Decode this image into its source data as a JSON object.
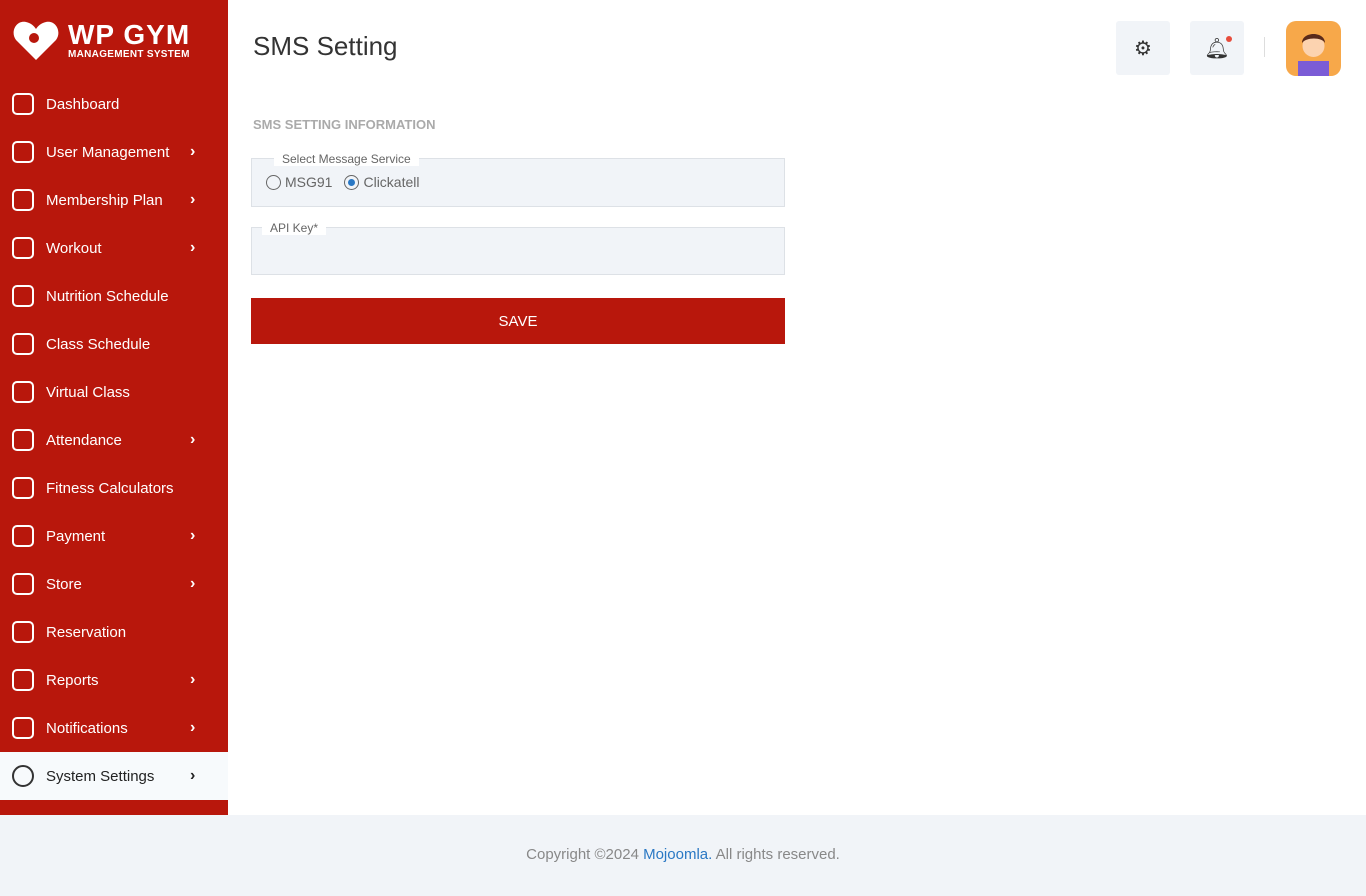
{
  "logo": {
    "title": "WP GYM",
    "subtitle": "MANAGEMENT SYSTEM"
  },
  "sidebar": {
    "items": [
      {
        "label": "Dashboard",
        "icon": "grid-icon",
        "chevron": false
      },
      {
        "label": "User Management",
        "icon": "users-icon",
        "chevron": true
      },
      {
        "label": "Membership Plan",
        "icon": "card-icon",
        "chevron": true
      },
      {
        "label": "Workout",
        "icon": "workout-icon",
        "chevron": true
      },
      {
        "label": "Nutrition Schedule",
        "icon": "clipboard-icon",
        "chevron": false
      },
      {
        "label": "Class Schedule",
        "icon": "calendar-icon",
        "chevron": false
      },
      {
        "label": "Virtual Class",
        "icon": "screen-icon",
        "chevron": false
      },
      {
        "label": "Attendance",
        "icon": "user-check-icon",
        "chevron": true
      },
      {
        "label": "Fitness Calculators",
        "icon": "calculator-icon",
        "chevron": false
      },
      {
        "label": "Payment",
        "icon": "payment-icon",
        "chevron": true
      },
      {
        "label": "Store",
        "icon": "store-icon",
        "chevron": true
      },
      {
        "label": "Reservation",
        "icon": "reservation-icon",
        "chevron": false
      },
      {
        "label": "Reports",
        "icon": "report-icon",
        "chevron": true
      },
      {
        "label": "Notifications",
        "icon": "bell-icon",
        "chevron": true
      },
      {
        "label": "System Settings",
        "icon": "gear-icon",
        "chevron": true,
        "active": true
      }
    ]
  },
  "header": {
    "title": "SMS Setting"
  },
  "form": {
    "section_title": "SMS SETTING INFORMATION",
    "service_legend": "Select Message Service",
    "options": [
      "MSG91",
      "Clickatell"
    ],
    "selected": "Clickatell",
    "api_key_legend": "API Key*",
    "api_key_value": "",
    "save_label": "SAVE"
  },
  "footer": {
    "prefix": "Copyright ©2024 ",
    "link": "Mojoomla.",
    "suffix": " All rights reserved."
  },
  "colors": {
    "brand": "#b8170c",
    "accent": "#2a78c4"
  }
}
